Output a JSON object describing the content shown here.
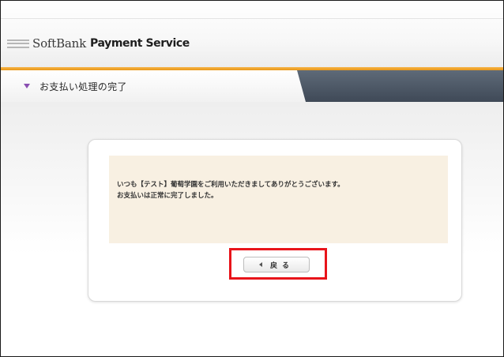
{
  "header": {
    "logo_softbank": "SoftBank",
    "logo_payment_service": "Payment Service"
  },
  "nav": {
    "title": "お支払い処理の完了"
  },
  "message": {
    "line1": "いつも【テスト】葡萄学園をご利用いただきましてありがとうございます。",
    "line2": "お支払いは正常に完了しました。"
  },
  "buttons": {
    "back_label": "戻る"
  },
  "colors": {
    "accent_orange": "#e99617",
    "nav_marker_purple": "#8a4fb1",
    "message_background": "#f8f0e2",
    "highlight_red": "#e8141a"
  },
  "icons": {
    "logo": "softbank-stripes-icon",
    "nav_marker": "triangle-down-icon",
    "back": "triangle-left-icon"
  }
}
